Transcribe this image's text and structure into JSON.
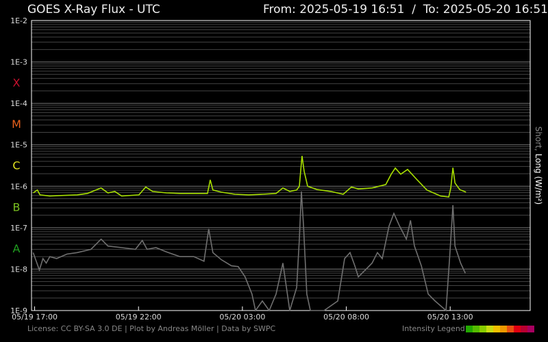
{
  "header": {
    "title": "GOES X-Ray Flux - UTC",
    "range": "From: 2025-05-19 16:51  /  To: 2025-05-20 16:51"
  },
  "footer": {
    "license": "License: CC BY-SA 3.0 DE | Plot by Andreas Möller | Data by SWPC",
    "legend_label": "Intensity Legend",
    "legend_colors": [
      "#22a800",
      "#55bb00",
      "#88cc00",
      "#c8dc10",
      "#f0c000",
      "#ee9900",
      "#e85010",
      "#e00010",
      "#b80030",
      "#a80060"
    ]
  },
  "chart_data": {
    "type": "line",
    "title": "GOES X-Ray Flux - UTC",
    "ylabel_short": "Short,",
    "ylabel_long": "Long (W/m²)",
    "yscale": "log",
    "ylim": [
      1e-09,
      0.01
    ],
    "yticks": [
      "1E-2",
      "1E-3",
      "1E-4",
      "1E-5",
      "1E-6",
      "1E-7",
      "1E-8",
      "1E-9"
    ],
    "xlim_hours_from_0519_1700": [
      -0.15,
      23.85
    ],
    "xticks": [
      {
        "label": "05/19 17:00",
        "t": 0
      },
      {
        "label": "05/19 22:00",
        "t": 5
      },
      {
        "label": "05/20 03:00",
        "t": 10
      },
      {
        "label": "05/20 08:00",
        "t": 15
      },
      {
        "label": "05/20 13:00",
        "t": 20
      }
    ],
    "classes": [
      {
        "label": "X",
        "color": "#c8102e",
        "flux": 0.00032
      },
      {
        "label": "M",
        "color": "#e8601c",
        "flux": 3.2e-05
      },
      {
        "label": "C",
        "color": "#e0e020",
        "flux": 3.2e-06
      },
      {
        "label": "B",
        "color": "#7ac020",
        "flux": 3.2e-07
      },
      {
        "label": "A",
        "color": "#20a020",
        "flux": 3.2e-08
      }
    ],
    "series": [
      {
        "name": "Long",
        "color": "#a8e000",
        "t": [
          -0.07,
          0.13,
          0.26,
          0.73,
          1.39,
          2.05,
          2.54,
          3.2,
          3.53,
          3.86,
          4.19,
          5.02,
          5.35,
          5.68,
          6.34,
          7.0,
          7.66,
          8.32,
          8.45,
          8.58,
          8.98,
          9.64,
          10.3,
          10.96,
          11.62,
          11.95,
          12.28,
          12.61,
          12.74,
          12.87,
          12.97,
          13.14,
          13.6,
          14.26,
          14.85,
          15.25,
          15.58,
          16.24,
          16.9,
          17.16,
          17.36,
          17.62,
          17.95,
          18.38,
          18.88,
          19.54,
          19.93,
          20.03,
          20.13,
          20.23,
          20.46,
          20.76
        ],
        "values": [
          6.9e-07,
          8.1e-07,
          6.2e-07,
          5.8e-07,
          6e-07,
          6.2e-07,
          6.7e-07,
          9.1e-07,
          6.9e-07,
          7.5e-07,
          5.8e-07,
          6.2e-07,
          9.6e-07,
          7.5e-07,
          6.9e-07,
          6.7e-07,
          6.7e-07,
          6.7e-07,
          1.43e-06,
          8.1e-07,
          7.2e-07,
          6.4e-07,
          6.2e-07,
          6.4e-07,
          6.7e-07,
          9.1e-07,
          7.5e-07,
          8.1e-07,
          1e-06,
          5.4e-06,
          2.3e-06,
          1e-06,
          8.3e-07,
          7.5e-07,
          6.4e-07,
          9.6e-07,
          8.6e-07,
          9.1e-07,
          1.1e-06,
          1.95e-06,
          2.75e-06,
          1.95e-06,
          2.55e-06,
          1.48e-06,
          8.1e-07,
          5.8e-07,
          5.5e-07,
          9.1e-07,
          2.8e-06,
          1.2e-06,
          8.3e-07,
          7.2e-07
        ]
      },
      {
        "name": "Short",
        "color": "#707070",
        "t": [
          -0.07,
          0.23,
          0.4,
          0.56,
          0.73,
          1.06,
          1.55,
          2.05,
          2.71,
          3.2,
          3.53,
          4.19,
          4.85,
          5.18,
          5.41,
          5.84,
          6.34,
          7.0,
          7.66,
          8.15,
          8.38,
          8.58,
          8.98,
          9.47,
          9.8,
          10.13,
          10.46,
          10.63,
          10.96,
          11.29,
          11.62,
          11.95,
          12.28,
          12.61,
          12.74,
          12.84,
          12.94,
          13.1,
          13.27,
          13.93,
          14.59,
          14.92,
          15.18,
          15.41,
          15.58,
          15.91,
          16.24,
          16.5,
          16.73,
          17.06,
          17.29,
          17.56,
          17.89,
          18.09,
          18.28,
          18.61,
          18.94,
          19.27,
          19.8,
          19.97,
          20.13,
          20.23,
          20.5,
          20.73
        ],
        "values": [
          2.5e-08,
          9.5e-09,
          1.8e-08,
          1.4e-08,
          2e-08,
          1.8e-08,
          2.3e-08,
          2.5e-08,
          3e-08,
          5.3e-08,
          3.6e-08,
          3.3e-08,
          3e-08,
          4.9e-08,
          3e-08,
          3.3e-08,
          2.6e-08,
          2e-08,
          2e-08,
          1.55e-08,
          9.3e-08,
          2.5e-08,
          1.7e-08,
          1.2e-08,
          1.15e-08,
          6.5e-09,
          2.5e-09,
          1e-09,
          1.7e-09,
          1e-09,
          2.5e-09,
          1.4e-08,
          1e-09,
          3.6e-09,
          5.3e-08,
          7.5e-07,
          1.1e-07,
          2.5e-09,
          1e-09,
          1e-09,
          1.7e-09,
          1.8e-08,
          2.5e-08,
          1.2e-08,
          6.5e-09,
          9.5e-09,
          1.4e-08,
          2.5e-08,
          1.8e-08,
          1.1e-07,
          2.2e-07,
          1.1e-07,
          5.3e-08,
          1.5e-07,
          3.6e-08,
          1.2e-08,
          2.5e-09,
          1.7e-09,
          1e-09,
          1.8e-08,
          3.5e-07,
          3.6e-08,
          1.4e-08,
          7.9e-09
        ]
      }
    ]
  }
}
